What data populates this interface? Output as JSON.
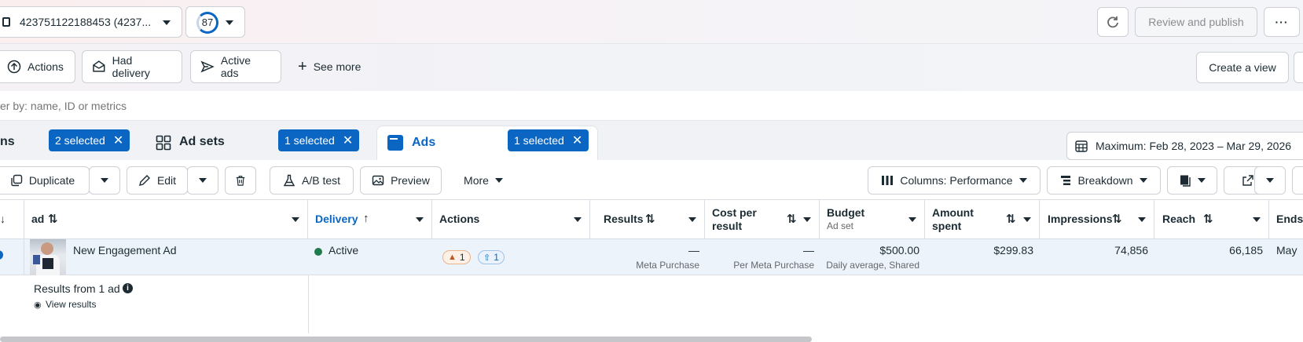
{
  "topbar": {
    "account_label": "423751122188453 (4237...",
    "score": "87",
    "review_publish": "Review and publish"
  },
  "filters": {
    "actions": "Actions",
    "had_delivery": "Had delivery",
    "active_ads": "Active ads",
    "see_more": "See more",
    "create_view": "Create a view"
  },
  "search": {
    "placeholder": "er by: name, ID or metrics"
  },
  "tabs": {
    "campaigns_label": "ns",
    "campaigns_selected": "2 selected",
    "adsets_label": "Ad sets",
    "adsets_selected": "1 selected",
    "ads_label": "Ads",
    "ads_selected": "1 selected",
    "date_range": "Maximum: Feb 28, 2023 – Mar 29, 2026"
  },
  "toolbar": {
    "duplicate": "Duplicate",
    "edit": "Edit",
    "ab_test": "A/B test",
    "preview": "Preview",
    "more": "More",
    "columns": "Columns: Performance",
    "breakdown": "Breakdown"
  },
  "table": {
    "headers": {
      "ad": "ad",
      "delivery": "Delivery",
      "actions": "Actions",
      "results": "Results",
      "cost_per_result_1": "Cost per",
      "cost_per_result_2": "result",
      "budget": "Budget",
      "budget_sub": "Ad set",
      "amount_spent_1": "Amount",
      "amount_spent_2": "spent",
      "impressions": "Impressions",
      "reach": "Reach",
      "ends": "Ends"
    },
    "row": {
      "ad_name": "New Engagement Ad",
      "delivery": "Active",
      "warnings": "1",
      "actions_count": "1",
      "results": "—",
      "results_sub": "Meta Purchase",
      "cost": "—",
      "cost_sub": "Per Meta Purchase",
      "budget": "$500.00",
      "budget_sub": "Daily average, Shared",
      "amount_spent": "$299.83",
      "impressions": "74,856",
      "reach": "66,185",
      "ends": "May"
    },
    "summary": {
      "results_from": "Results from 1 ad",
      "view_results": "View results"
    }
  },
  "colors": {
    "accent": "#0a66c2",
    "active_dot": "#1f7a4d",
    "warning": "#c4541b"
  }
}
